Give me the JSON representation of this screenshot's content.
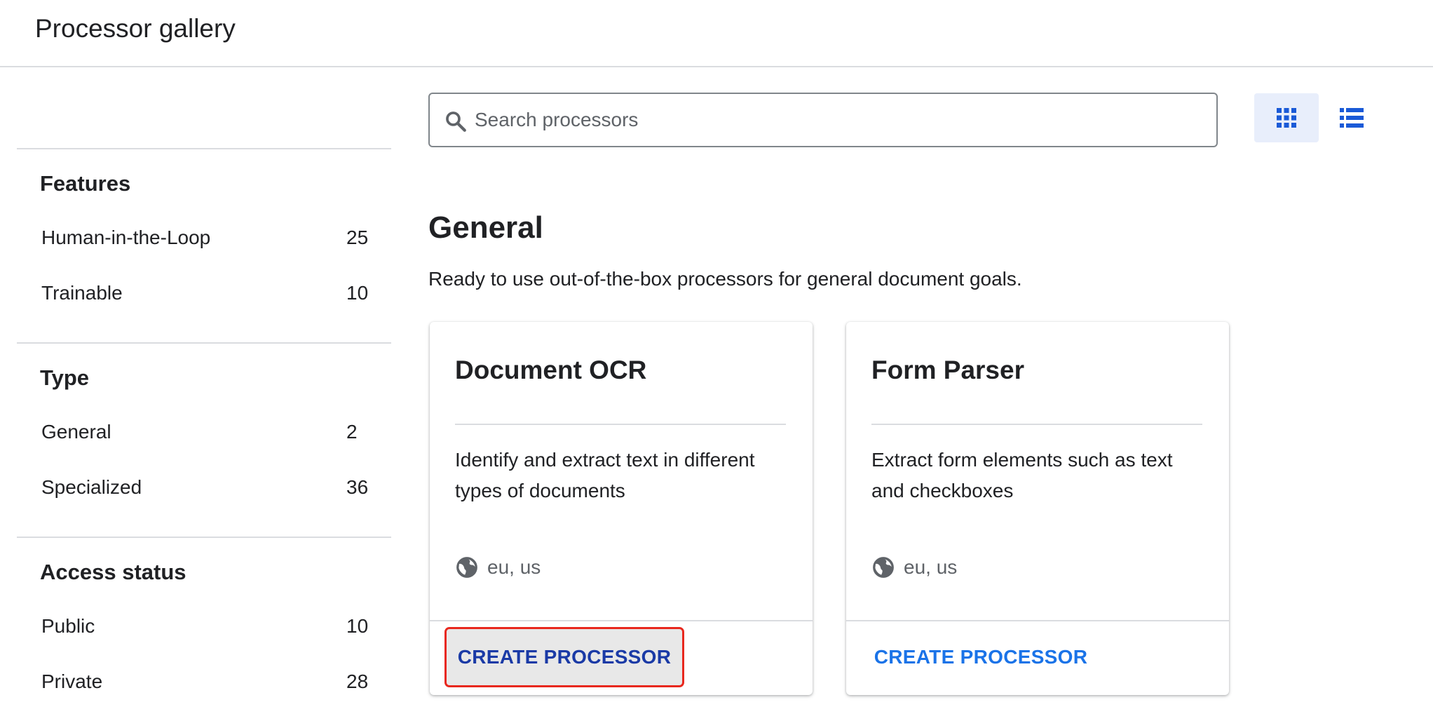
{
  "header": {
    "title": "Processor gallery"
  },
  "sidebar": {
    "groups": [
      {
        "title": "Features",
        "items": [
          {
            "label": "Human-in-the-Loop",
            "count": "25"
          },
          {
            "label": "Trainable",
            "count": "10"
          }
        ]
      },
      {
        "title": "Type",
        "items": [
          {
            "label": "General",
            "count": "2"
          },
          {
            "label": "Specialized",
            "count": "36"
          }
        ]
      },
      {
        "title": "Access status",
        "items": [
          {
            "label": "Public",
            "count": "10"
          },
          {
            "label": "Private",
            "count": "28"
          }
        ]
      }
    ]
  },
  "search": {
    "placeholder": "Search processors",
    "value": ""
  },
  "view_toggle": {
    "active": "grid",
    "accent": "#1a5ad7"
  },
  "section": {
    "title": "General",
    "description": "Ready to use out-of-the-box processors for general document goals."
  },
  "cards": [
    {
      "title": "Document OCR",
      "description": "Identify and extract text in different types of documents",
      "regions": "eu, us",
      "action_label": "CREATE PROCESSOR"
    },
    {
      "title": "Form Parser",
      "description": "Extract form elements such as text and checkboxes",
      "regions": "eu, us",
      "action_label": "CREATE PROCESSOR"
    }
  ],
  "colors": {
    "link_blue": "#1a73e8",
    "highlight_red": "#e8281e",
    "divider": "#dadce0"
  }
}
